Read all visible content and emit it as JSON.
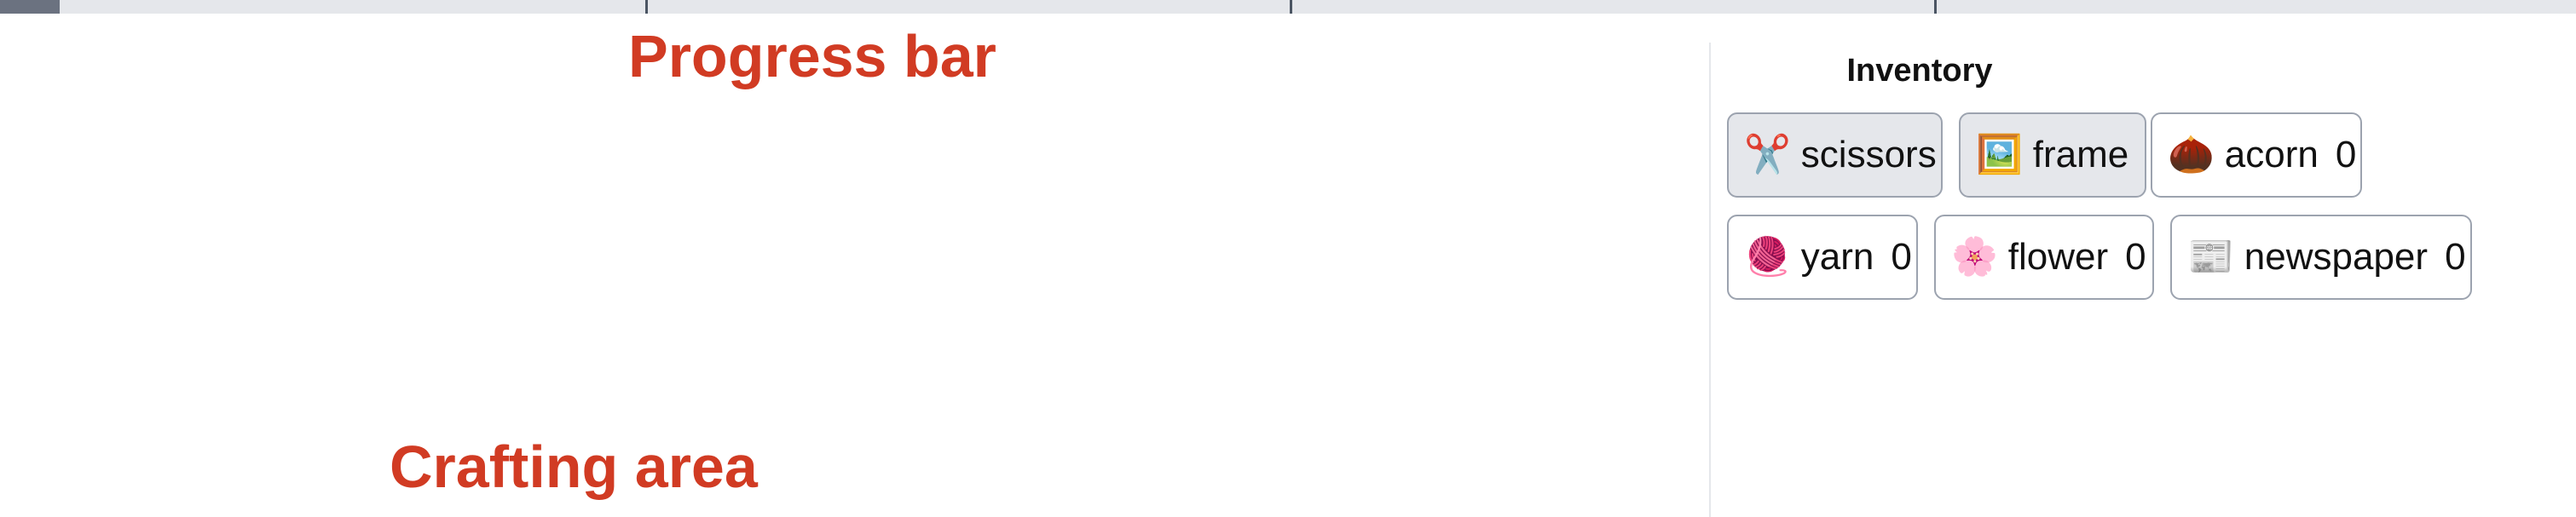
{
  "progress": {
    "fraction": 0.023,
    "segments": 4
  },
  "annotations": {
    "progress_label": "Progress bar",
    "crafting_label": "Crafting area"
  },
  "inventory": {
    "title": "Inventory",
    "items": [
      {
        "icon": "✂️",
        "icon_name": "scissors-icon",
        "label": "scissors",
        "count": "",
        "selected": true
      },
      {
        "icon": "🖼️",
        "icon_name": "frame-icon",
        "label": "frame",
        "count": "",
        "selected": true
      },
      {
        "icon": "🌰",
        "icon_name": "acorn-icon",
        "label": "acorn",
        "count": "0",
        "selected": false
      },
      {
        "icon": "🧶",
        "icon_name": "yarn-icon",
        "label": "yarn",
        "count": "0",
        "selected": false
      },
      {
        "icon": "🌸",
        "icon_name": "flower-icon",
        "label": "flower",
        "count": "0",
        "selected": false
      },
      {
        "icon": "📰",
        "icon_name": "newspaper-icon",
        "label": "newspaper",
        "count": "0",
        "selected": false
      }
    ]
  },
  "colors": {
    "annotation": "#d13b23",
    "progress_track": "#e5e7eb",
    "progress_fill": "#6b7280"
  }
}
